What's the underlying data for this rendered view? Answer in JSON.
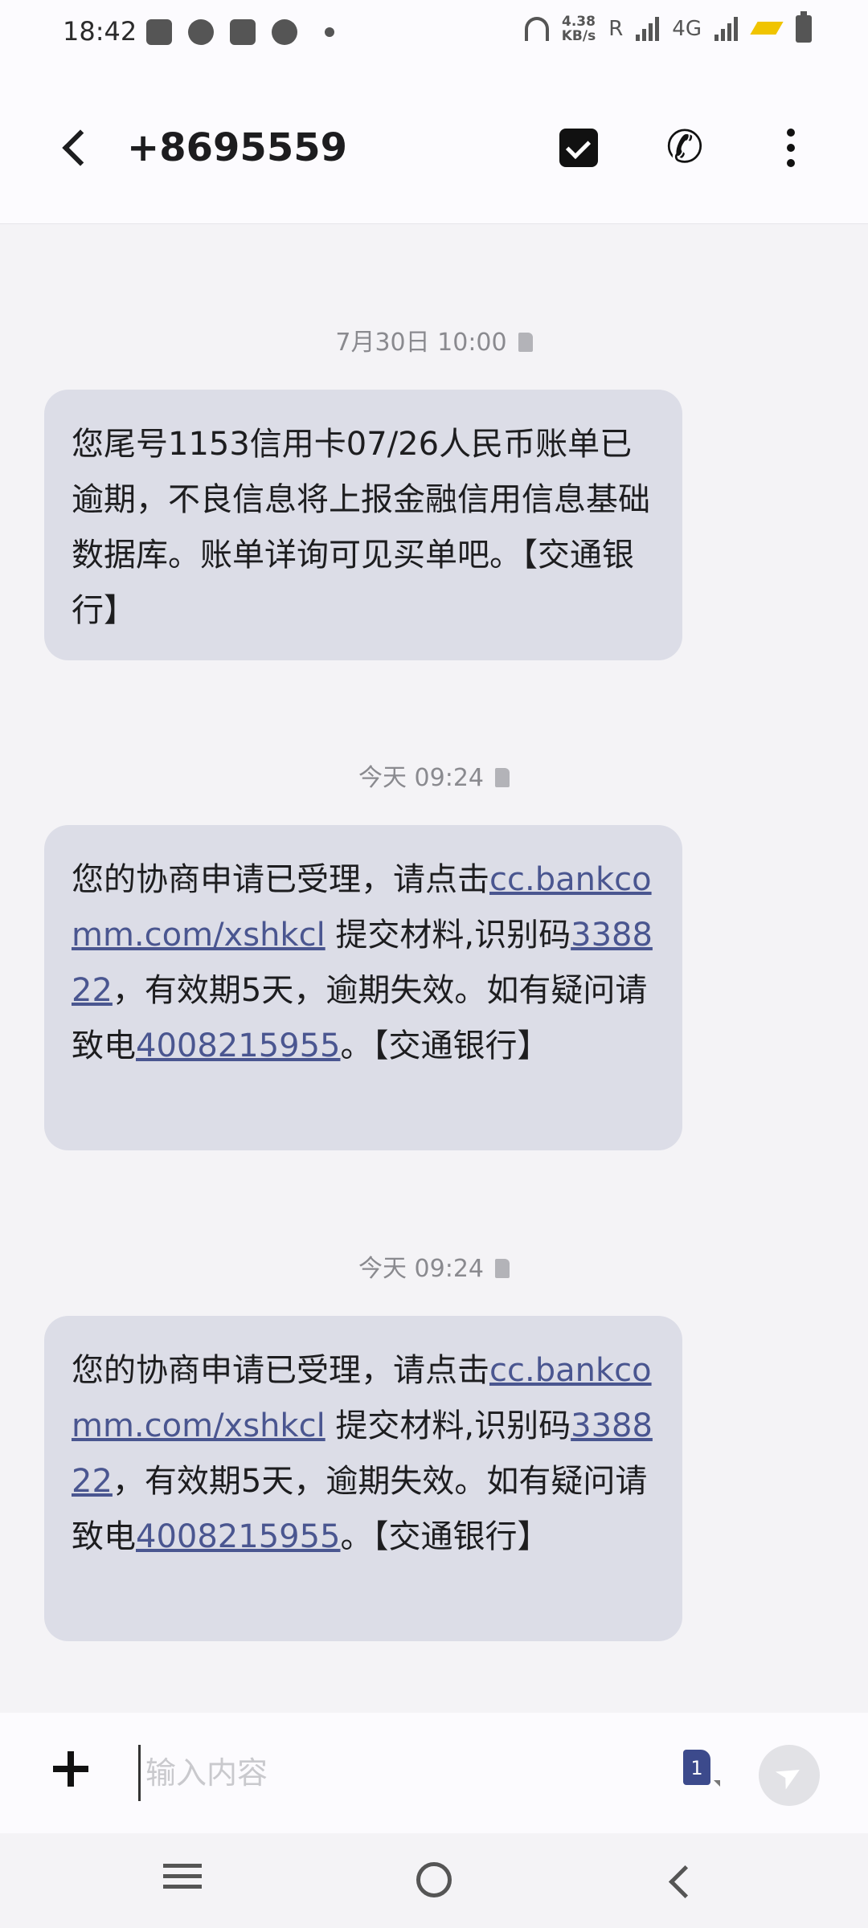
{
  "status_bar": {
    "time": "18:42",
    "speed_value": "4.38",
    "speed_unit": "KB/s",
    "roaming": "R",
    "network": "4G",
    "left_icons": [
      "bag-icon",
      "speedometer-icon",
      "bag-icon",
      "chat-icon"
    ],
    "right_icons": [
      "headphones-icon",
      "signal-icon",
      "signal-icon",
      "charging-icon",
      "battery-icon"
    ]
  },
  "header": {
    "title": "+8695559",
    "icons": [
      "back-arrow-icon",
      "checkbox-icon",
      "phone-icon",
      "more-vertical-icon"
    ]
  },
  "messages": [
    {
      "timestamp": "7月30日 10:00",
      "parts": [
        "您尾号1153信用卡07/26人民币账单已逾期，不良信息将上报金融信用信息基础数据库。账单详询可见买单吧。【交通银行】"
      ]
    },
    {
      "timestamp": "今天 09:24",
      "text_before": "您的协商申请已受理，请点击",
      "link": "cc.bankcomm.com/xshkcl",
      "text_mid1": " 提交材料,识别码",
      "code": "338822",
      "text_mid2": "，有效期5天，逾期失效。如有疑问请致电",
      "phone": "4008215955",
      "text_after": "。【交通银行】"
    },
    {
      "timestamp": "今天 09:24",
      "text_before": "您的协商申请已受理，请点击",
      "link": "cc.bankcomm.com/xshkcl",
      "text_mid1": " 提交材料,识别码",
      "code": "338822",
      "text_mid2": "，有效期5天，逾期失效。如有疑问请致电",
      "phone": "4008215955",
      "text_after": "。【交通银行】"
    }
  ],
  "compose": {
    "placeholder": "输入内容",
    "sim_slot": "1",
    "icons": [
      "plus-icon",
      "sim-card-icon",
      "send-icon"
    ]
  },
  "nav_bar": {
    "icons": [
      "menu-icon",
      "home-icon",
      "back-icon"
    ]
  }
}
